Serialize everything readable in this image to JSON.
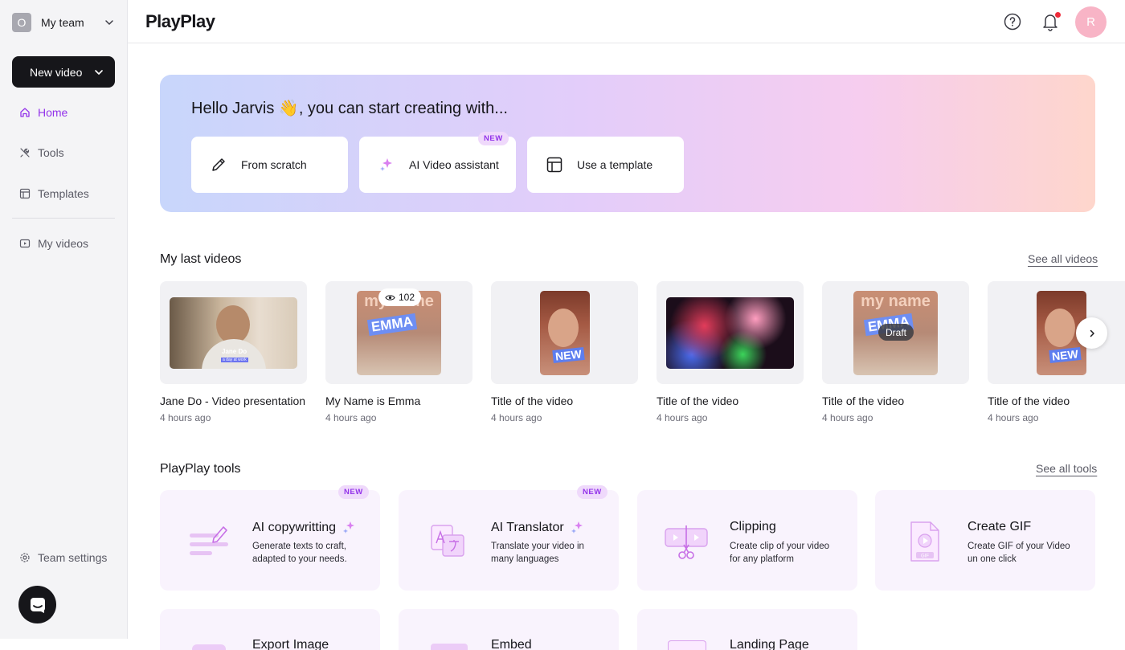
{
  "sidebar": {
    "team_initial": "O",
    "team_name": "My team",
    "new_video_label": "New video",
    "items": [
      {
        "label": "Home",
        "icon": "home-icon",
        "active": true
      },
      {
        "label": "Tools",
        "icon": "tools-icon"
      },
      {
        "label": "Templates",
        "icon": "templates-icon"
      },
      {
        "label": "My videos",
        "icon": "my-videos-icon"
      }
    ],
    "team_settings_label": "Team settings"
  },
  "header": {
    "logo": "PlayPlay",
    "user_initial": "R"
  },
  "hero": {
    "greeting": "Hello Jarvis 👋, you can start creating with...",
    "options": [
      {
        "label": "From scratch",
        "icon": "pencil-icon"
      },
      {
        "label": "AI Video assistant",
        "icon": "sparkle-icon",
        "badge": "NEW"
      },
      {
        "label": "Use a template",
        "icon": "template-layout-icon"
      }
    ]
  },
  "last_videos": {
    "title": "My last videos",
    "see_all": "See all videos",
    "items": [
      {
        "title": "Jane Do - Video presentation",
        "time": "4 hours ago",
        "overlay_name": "Jane Do",
        "overlay_sub": "a day at work"
      },
      {
        "title": "My Name is Emma",
        "time": "4 hours ago",
        "views": "102",
        "overlay_line1": "my name",
        "overlay_line2": "EMMA"
      },
      {
        "title": "Title of the video",
        "time": "4 hours ago",
        "overlay_tag": "NEW"
      },
      {
        "title": "Title of the video",
        "time": "4 hours ago"
      },
      {
        "title": "Title of the video",
        "time": "4 hours ago",
        "status": "Draft",
        "overlay_line1": "my name",
        "overlay_line2": "EMMA"
      },
      {
        "title": "Title of the video",
        "time": "4 hours ago",
        "overlay_tag": "NEW"
      }
    ]
  },
  "tools": {
    "title": "PlayPlay tools",
    "see_all": "See all tools",
    "items": [
      {
        "title": "AI copywritting",
        "desc": "Generate texts to craft, adapted to your needs.",
        "badge": "NEW"
      },
      {
        "title": "AI Translator",
        "desc": "Translate your video in many languages",
        "badge": "NEW"
      },
      {
        "title": "Clipping",
        "desc": "Create clip of your video for any platform"
      },
      {
        "title": "Create GIF",
        "desc": "Create GIF of your Video un one click",
        "gif_label": "GIF"
      },
      {
        "title": "Export Image"
      },
      {
        "title": "Embed"
      },
      {
        "title": "Landing Page"
      }
    ]
  },
  "colors": {
    "accent": "#9333ea",
    "dark": "#16161a",
    "tool_bg": "#f9f3fd"
  }
}
